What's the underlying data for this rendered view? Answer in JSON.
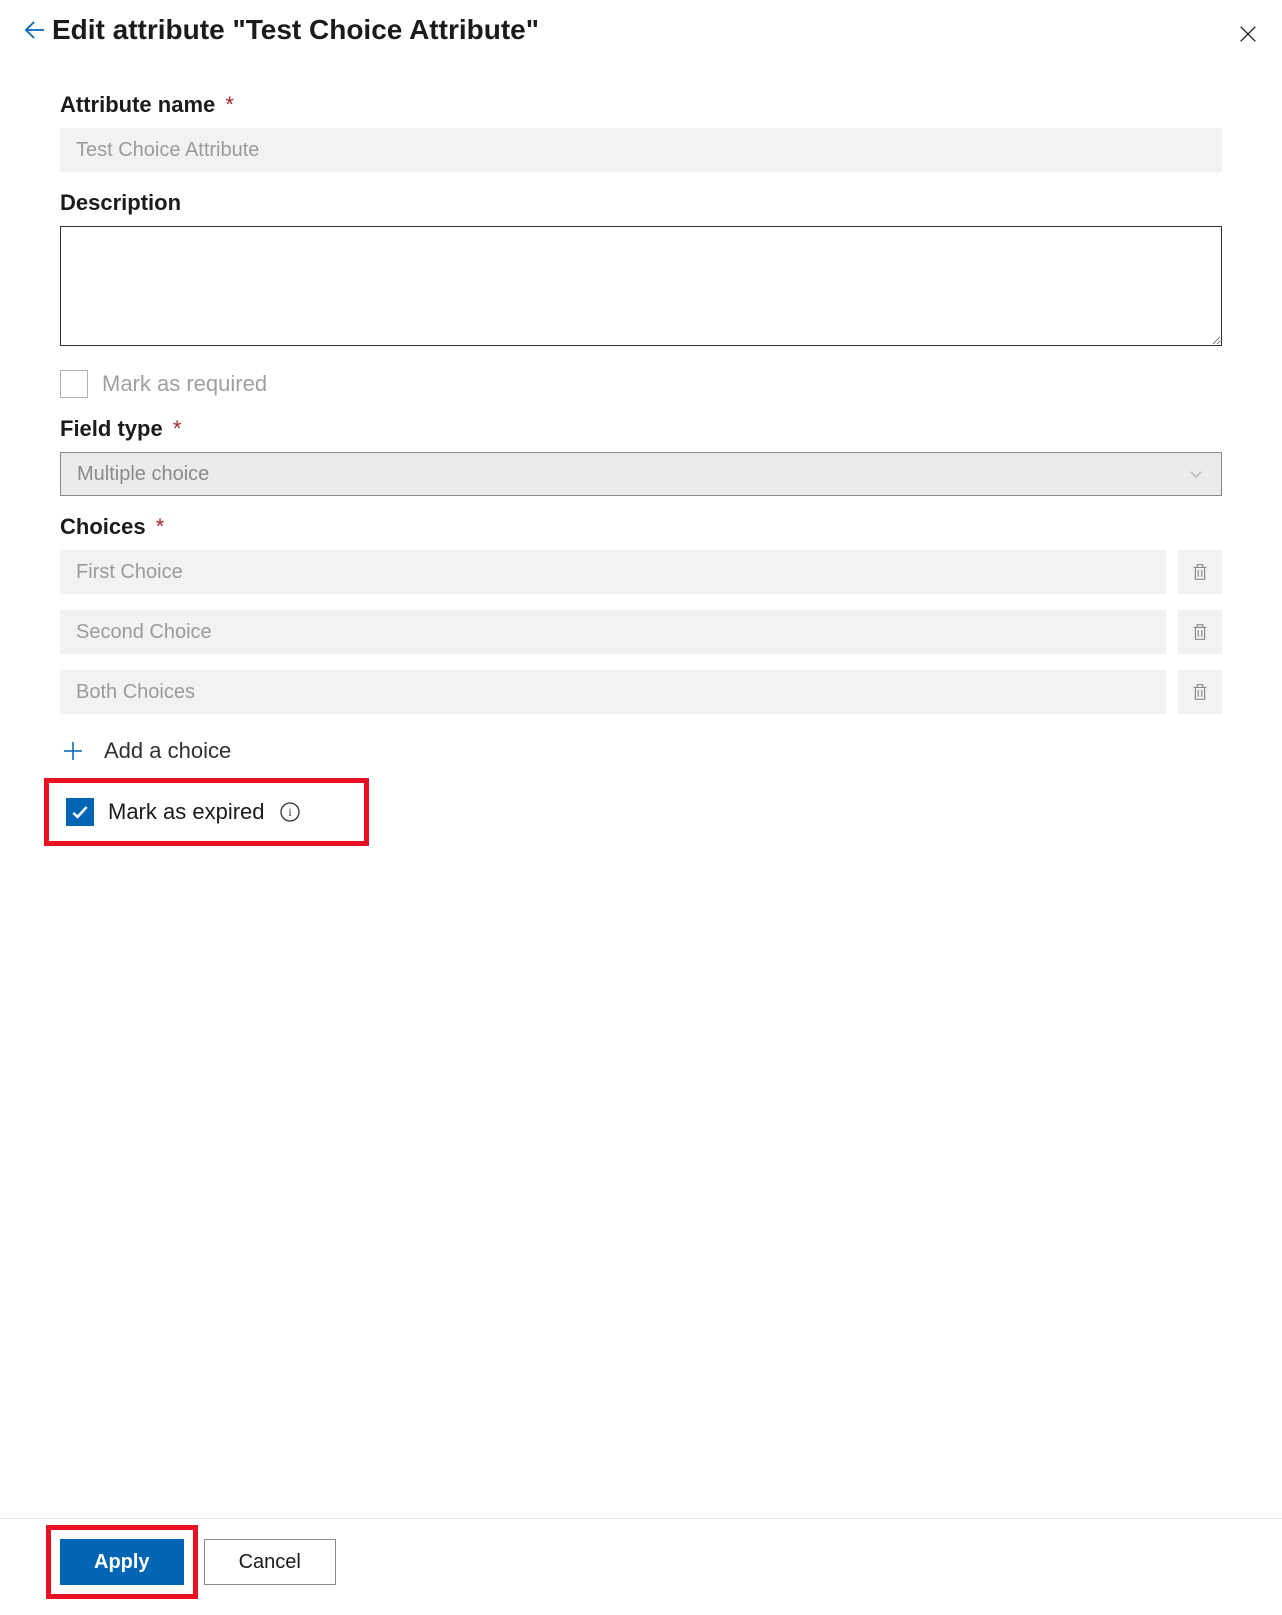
{
  "header": {
    "title": "Edit attribute \"Test Choice Attribute\""
  },
  "fields": {
    "name_label": "Attribute name",
    "name_value": "Test Choice Attribute",
    "description_label": "Description",
    "description_value": "",
    "mark_required_label": "Mark as required",
    "mark_required_checked": false,
    "field_type_label": "Field type",
    "field_type_value": "Multiple choice",
    "choices_label": "Choices",
    "choices": [
      "First Choice",
      "Second Choice",
      "Both Choices"
    ],
    "add_choice_label": "Add a choice",
    "mark_expired_label": "Mark as expired",
    "mark_expired_checked": true
  },
  "footer": {
    "apply_label": "Apply",
    "cancel_label": "Cancel"
  }
}
